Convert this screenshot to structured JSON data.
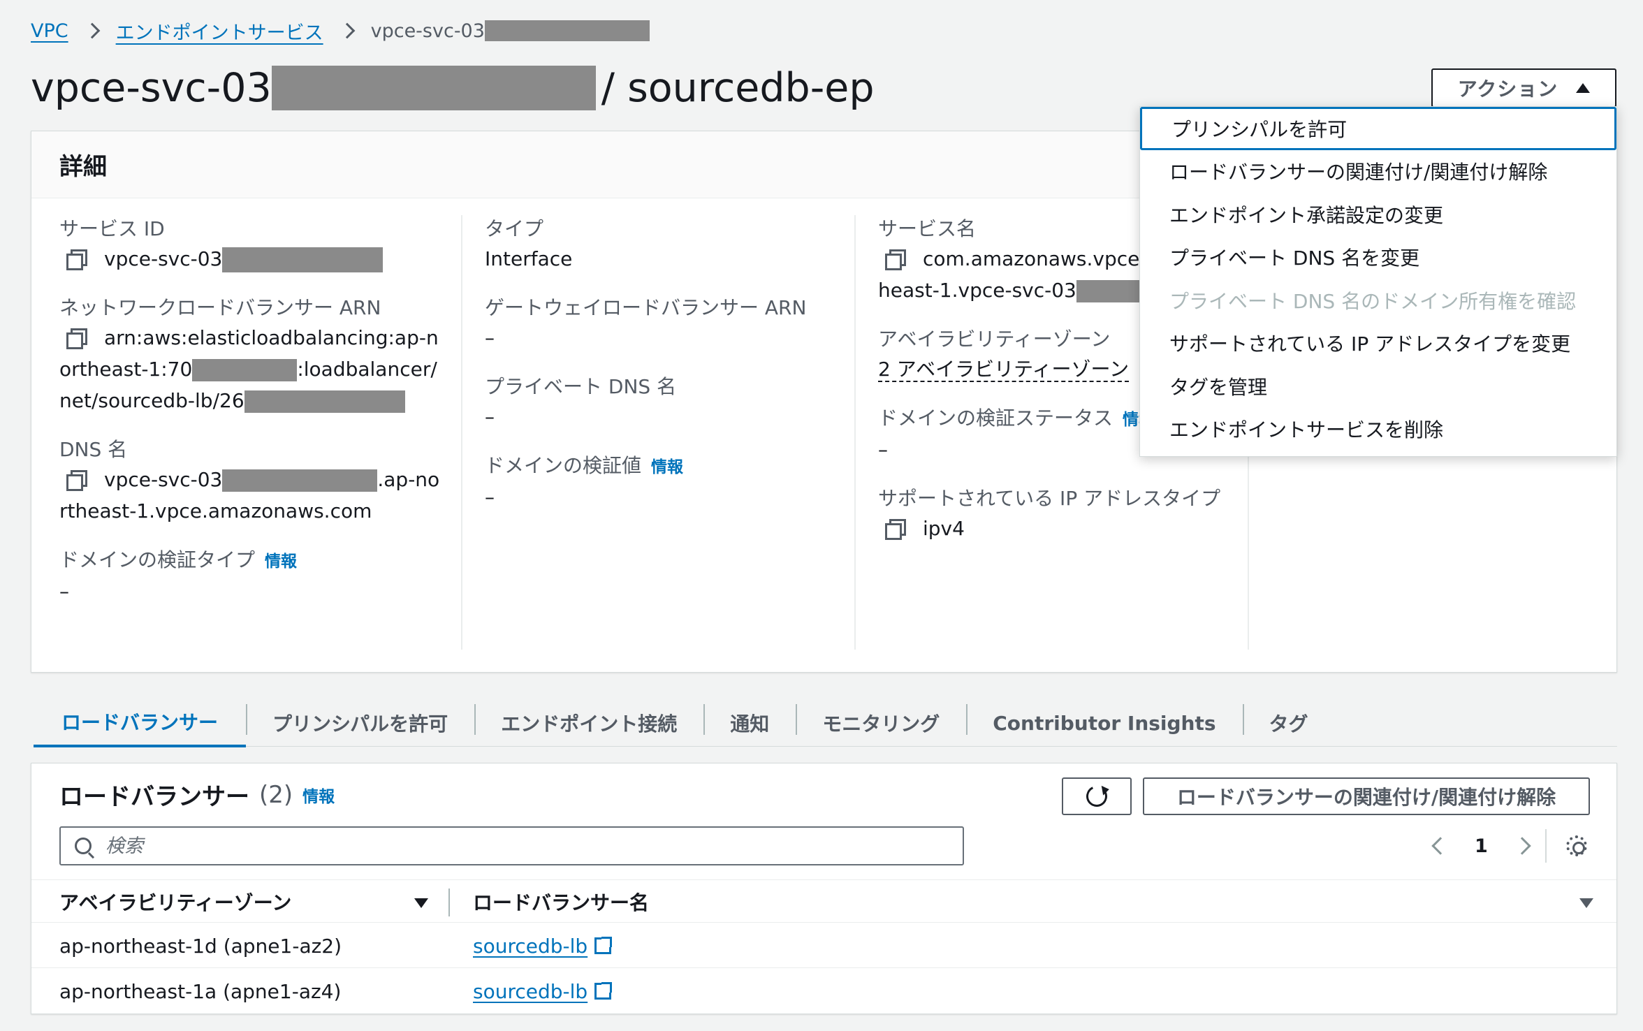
{
  "breadcrumb": {
    "vpc": "VPC",
    "endpoint_services": "エンドポイントサービス",
    "current": "vpce-svc-03"
  },
  "title": {
    "prefix": "vpce-svc-03",
    "suffix": "/ sourcedb-ep"
  },
  "actions": {
    "label": "アクション",
    "items": [
      {
        "label": "プリンシパルを許可",
        "state": "focused"
      },
      {
        "label": "ロードバランサーの関連付け/関連付け解除",
        "state": "enabled"
      },
      {
        "label": "エンドポイント承諾設定の変更",
        "state": "enabled"
      },
      {
        "label": "プライベート DNS 名を変更",
        "state": "enabled"
      },
      {
        "label": "プライベート DNS 名のドメイン所有権を確認",
        "state": "disabled"
      },
      {
        "label": "サポートされている IP アドレスタイプを変更",
        "state": "enabled"
      },
      {
        "label": "タグを管理",
        "state": "enabled"
      },
      {
        "label": "エンドポイントサービスを削除",
        "state": "enabled"
      }
    ]
  },
  "details": {
    "header": "詳細",
    "service_id_label": "サービス ID",
    "service_id_value": "vpce-svc-03",
    "nlb_arn_label": "ネットワークロードバランサー ARN",
    "nlb_arn_part1": "arn:aws:elasticloadbalancing:ap-northeast-1:70",
    "nlb_arn_part2": ":loadbalancer/net/sourcedb-lb/26",
    "dns_label": "DNS 名",
    "dns_part1": "vpce-svc-03",
    "dns_part2": ".ap-northeast-1.vpce.amazonaws.com",
    "domain_verify_type_label": "ドメインの検証タイプ",
    "domain_verify_type_value": "–",
    "type_label": "タイプ",
    "type_value": "Interface",
    "gwlb_arn_label": "ゲートウェイロードバランサー ARN",
    "gwlb_arn_value": "–",
    "private_dns_label": "プライベート DNS 名",
    "private_dns_value": "–",
    "domain_verify_value_label": "ドメインの検証値",
    "domain_verify_value_value": "–",
    "service_name_label": "サービス名",
    "service_name_part1": "com.amazonaws.vpce.ap-northeast-1.vpce-svc-03",
    "az_label": "アベイラビリティーゾーン",
    "az_value": "2 アベイラビリティーゾーン",
    "domain_verify_status_label": "ドメインの検証ステータス",
    "domain_verify_status_value": "–",
    "ip_type_label": "サポートされている IP アドレスタイプ",
    "ip_type_value": "ipv4",
    "info": "情報"
  },
  "tabs": [
    {
      "label": "ロードバランサー",
      "active": true
    },
    {
      "label": "プリンシパルを許可"
    },
    {
      "label": "エンドポイント接続"
    },
    {
      "label": "通知"
    },
    {
      "label": "モニタリング"
    },
    {
      "label": "Contributor Insights"
    },
    {
      "label": "タグ"
    }
  ],
  "lb_table": {
    "title": "ロードバランサー",
    "count": "(2)",
    "info": "情報",
    "assoc_button": "ロードバランサーの関連付け/関連付け解除",
    "search_placeholder": "検索",
    "page": "1",
    "columns": [
      "アベイラビリティーゾーン",
      "ロードバランサー名"
    ],
    "rows": [
      {
        "az": "ap-northeast-1d (apne1-az2)",
        "lb": "sourcedb-lb"
      },
      {
        "az": "ap-northeast-1a (apne1-az4)",
        "lb": "sourcedb-lb"
      }
    ]
  }
}
